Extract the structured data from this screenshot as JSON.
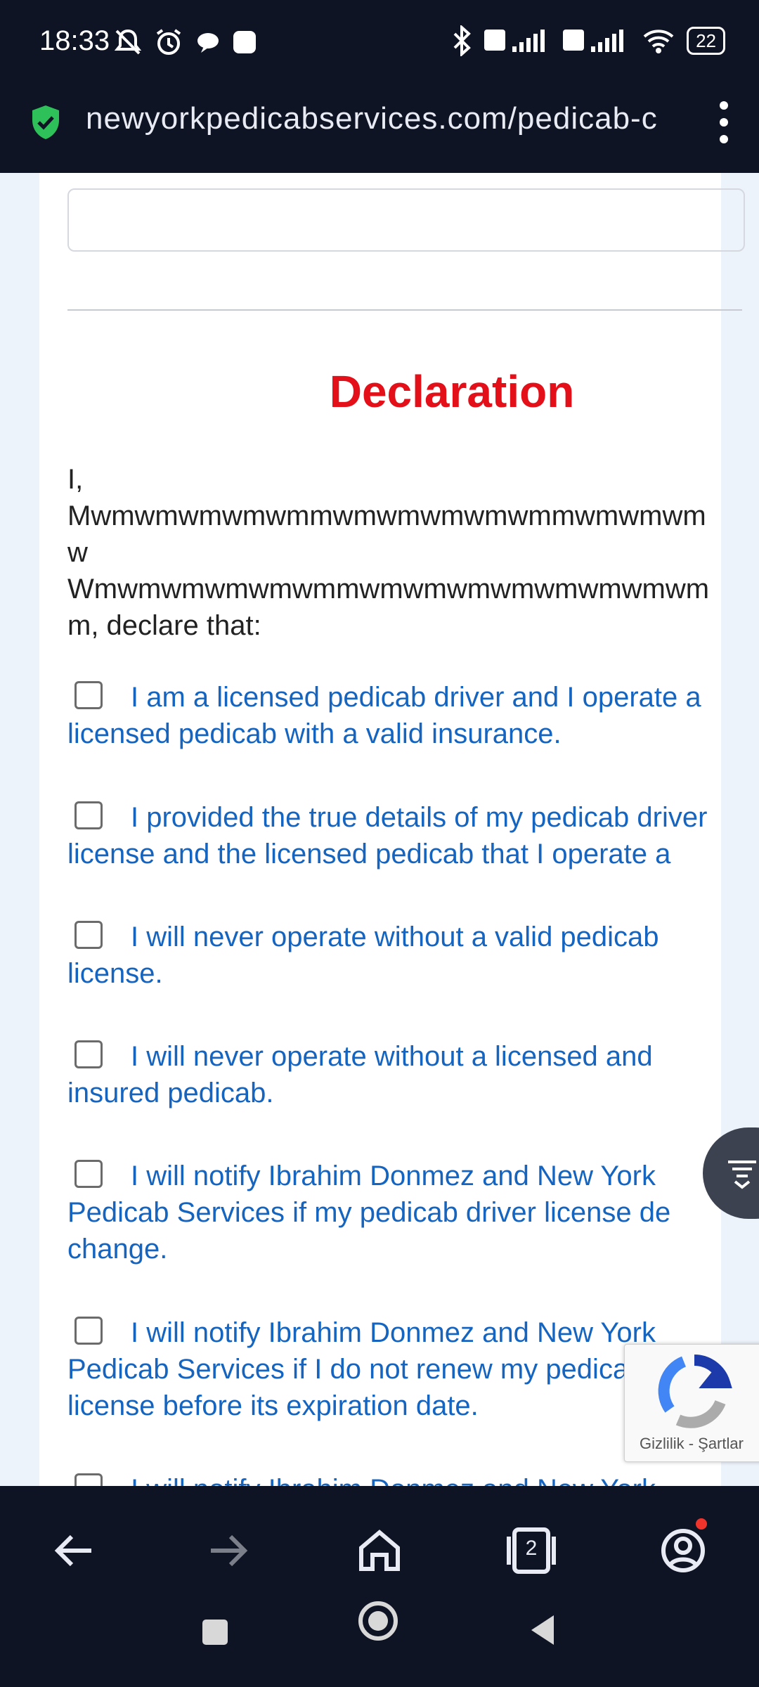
{
  "status_bar": {
    "time": "18:33",
    "battery": "22"
  },
  "browser": {
    "url": "newyorkpedicabservices.com/pedicab-c",
    "tab_count": "2"
  },
  "page": {
    "heading": "Declaration",
    "intro": "I,\nMwmwmwmwmwmmwmwmwmwmwmmwmwmwm\nw\nWmwmwmwmwmwmmwmwmwmwmwmwmwmwm\nm, declare that:",
    "declarations": [
      {
        "label": "I am a licensed pedicab driver and I operate a\nlicensed pedicab with a valid insurance.",
        "checked": false
      },
      {
        "label": "I provided the true details of my pedicab driver\nlicense and the licensed pedicab that I operate a",
        "checked": false
      },
      {
        "label": "I will never operate without a valid pedicab\nlicense.",
        "checked": false
      },
      {
        "label": "I will never operate without a licensed and\ninsured pedicab.",
        "checked": false
      },
      {
        "label": "I will notify Ibrahim Donmez and New York\nPedicab Services if my pedicab driver license de\nchange.",
        "checked": false
      },
      {
        "label": "I will notify Ibrahim Donmez and New York\nPedicab Services if I do not renew my pedicab\nlicense before its expiration date.",
        "checked": false
      },
      {
        "label": "I will notify Ibrahim Donmez and New York",
        "checked": false
      }
    ]
  },
  "recaptcha": {
    "links": "Gizlilik - Şartlar"
  },
  "colors": {
    "heading": "#e3101a",
    "link_blue": "#1565c0",
    "chrome_dark": "#0f1424"
  }
}
